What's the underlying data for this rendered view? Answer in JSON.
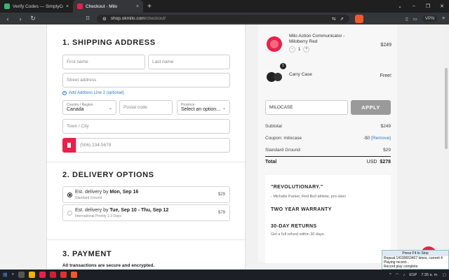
{
  "browser": {
    "tabs": [
      {
        "title": "Verify Codes — SimplyCodes",
        "active": false
      },
      {
        "title": "Checkout - Milo",
        "active": true
      }
    ],
    "url_host": "shop.okmilo.com",
    "url_path": "/checkout/",
    "vpn_label": "VPN"
  },
  "shipping": {
    "title": "1. SHIPPING ADDRESS",
    "first_name_placeholder": "First name",
    "last_name_placeholder": "Last name",
    "street_placeholder": "Street address",
    "add_line2": "Add Address Line 2 (optional)",
    "country_label": "Country / Region",
    "country_value": "Canada",
    "postal_placeholder": "Postal code",
    "province_label": "Province",
    "province_value": "Select an option...",
    "city_placeholder": "Town / City",
    "phone_placeholder": "(506) 234-5678"
  },
  "delivery": {
    "title": "2. DELIVERY OPTIONS",
    "options": [
      {
        "prefix": "Est. delivery by ",
        "date": "Mon, Sep 16",
        "method": "Standard Ground",
        "price": "$29",
        "selected": true
      },
      {
        "prefix": "Est. delivery by ",
        "date": "Tue, Sep 10 - Thu, Sep 12",
        "method": "International Priority 1-3 Days",
        "price": "$79",
        "selected": false
      }
    ]
  },
  "payment": {
    "title": "3. PAYMENT",
    "note": "All transactions are secure and encrypted."
  },
  "cart": {
    "items": [
      {
        "name": "Milo Action Communicator - Miloberry Red",
        "price": "$249",
        "qty": "1"
      },
      {
        "name": "Carry Case",
        "price": "Free!",
        "badge": "1"
      }
    ],
    "coupon_value": "MILOCASE",
    "apply_label": "APPLY",
    "subtotal_label": "Subtotal",
    "subtotal_value": "$249",
    "coupon_label": "Coupon: milocase",
    "coupon_amount": "-$0",
    "coupon_remove": "[Remove]",
    "shipping_label": "Standard Ground",
    "shipping_value": "$29",
    "total_label": "Total",
    "total_currency": "USD",
    "total_value": "$278"
  },
  "testimonial": {
    "quote": "\"REVOLUTIONARY.\"",
    "author": "- Michelle Parker, Red Bull athlete, pro-skier",
    "warranty": "TWO YEAR WARRANTY",
    "returns_title": "30-DAY RETURNS",
    "returns_text": "Get a full refund within 30 days."
  },
  "macro": {
    "header": "Press F4 to Stop",
    "line1": "Repeat 14100653407 times, current 4",
    "line2": "Playing record...",
    "line3": "Record play complete"
  },
  "taskbar": {
    "lang": "ESP",
    "time": "7:35 a. m."
  },
  "colors": {
    "brand_red": "#e8214b",
    "link_blue": "#2b79c2",
    "apply_gray": "#9a9a9a"
  }
}
